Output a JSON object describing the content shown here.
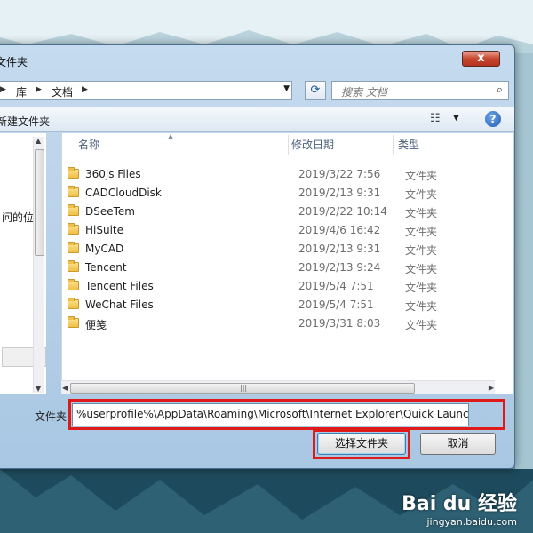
{
  "window": {
    "title": "文件夹",
    "close_glyph": "x"
  },
  "address": {
    "crumbs": [
      "库",
      "文档"
    ],
    "dropdown": "▼"
  },
  "search": {
    "placeholder": "搜索 文档"
  },
  "toolbar": {
    "new_folder": "新建文件夹",
    "help": "?"
  },
  "nav": {
    "partial_item": "问的位置"
  },
  "columns": {
    "name": "名称",
    "date": "修改日期",
    "type": "类型"
  },
  "files": [
    {
      "name": "360js Files",
      "date": "2019/3/22 7:56",
      "type": "文件夹"
    },
    {
      "name": "CADCloudDisk",
      "date": "2019/2/13 9:31",
      "type": "文件夹"
    },
    {
      "name": "DSeeTem",
      "date": "2019/2/22 10:14",
      "type": "文件夹"
    },
    {
      "name": "HiSuite",
      "date": "2019/4/6 16:42",
      "type": "文件夹"
    },
    {
      "name": "MyCAD",
      "date": "2019/2/13 9:31",
      "type": "文件夹"
    },
    {
      "name": "Tencent",
      "date": "2019/2/13 9:24",
      "type": "文件夹"
    },
    {
      "name": "Tencent Files",
      "date": "2019/5/4 7:51",
      "type": "文件夹"
    },
    {
      "name": "WeChat Files",
      "date": "2019/5/4 7:51",
      "type": "文件夹"
    },
    {
      "name": "便笺",
      "date": "2019/3/31 8:03",
      "type": "文件夹"
    }
  ],
  "footer": {
    "folder_label": "文件夹",
    "folder_value": "%userprofile%\\AppData\\Roaming\\Microsoft\\Internet Explorer\\Quick Launch",
    "select_button": "选择文件夹",
    "cancel_button": "取消"
  },
  "watermark": {
    "logo": "Bai du 经验",
    "url": "jingyan.baidu.com"
  },
  "colors": {
    "highlight": "#e01919",
    "close": "#c7462f"
  }
}
